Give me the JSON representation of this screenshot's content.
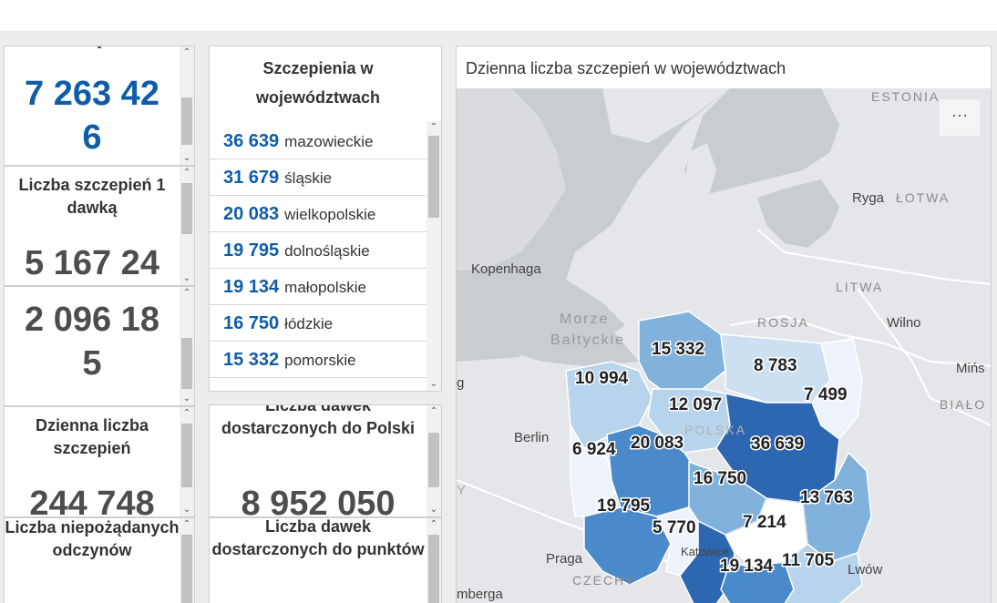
{
  "kpis": {
    "total": {
      "value": "7 263 42\n6"
    },
    "first_dose": {
      "label": "Liczba szczepień 1 dawką",
      "value": "5 167 24"
    },
    "second_dose": {
      "value": "2 096 18\n5"
    },
    "daily": {
      "label": "Dzienna liczba szczepień",
      "value": "244 748"
    },
    "adverse": {
      "label": "Liczba niepożądanych odczynów"
    },
    "delivered_poland": {
      "label": "Liczba dawek dostarczonych do Polski",
      "value": "8 952 050"
    },
    "delivered_points": {
      "label": "Liczba dawek dostarczonych do punktów"
    }
  },
  "voivodeships_list": {
    "title": "Szczepienia w województwach",
    "rows": [
      {
        "value": "36 639",
        "name": "mazowieckie"
      },
      {
        "value": "31 679",
        "name": "śląskie"
      },
      {
        "value": "20 083",
        "name": "wielkopolskie"
      },
      {
        "value": "19 795",
        "name": "dolnośląskie"
      },
      {
        "value": "19 134",
        "name": "małopolskie"
      },
      {
        "value": "16 750",
        "name": "łódzkie"
      },
      {
        "value": "15 332",
        "name": "pomorskie"
      }
    ]
  },
  "map": {
    "title": "Dzienna liczba szczepień w województwach",
    "menu_label": "···",
    "colors": {
      "lightest": "#eef3fb",
      "light": "#b7d4ec",
      "mid": "#80b2dc",
      "dark": "#4a8acb",
      "darkest": "#2e67b1",
      "sea": "#c9ccd1",
      "land": "#e4e6e9"
    },
    "place_labels": [
      "ESTONIA",
      "ŁOTWA",
      "Ryga",
      "Kopenhaga",
      "LITWA",
      "Wilno",
      "ROSJA",
      "Morze",
      "Bałtyckie",
      "Mińs",
      "BIAŁO",
      "Berlin",
      "POLSKA",
      "Praga",
      "CZECHY",
      "Lwów",
      "mberga",
      "Katowice",
      "g",
      "Y"
    ],
    "region_values": {
      "pomorskie": "15 332",
      "warminsko_mazurskie": "8 783",
      "podlaskie": "7 499",
      "zachodniopomorskie": "10 994",
      "kujawsko_pomorskie": "12 097",
      "lubuskie": "6 924",
      "wielkopolskie": "20 083",
      "mazowieckie": "36 639",
      "lodzkie": "16 750",
      "lubelskie": "13 763",
      "dolnoslaskie": "19 795",
      "opolskie": "5 770",
      "swietokrzyskie": "7 214",
      "slaskie": "",
      "malopolskie": "19 134",
      "podkarpackie": "11 705"
    }
  }
}
